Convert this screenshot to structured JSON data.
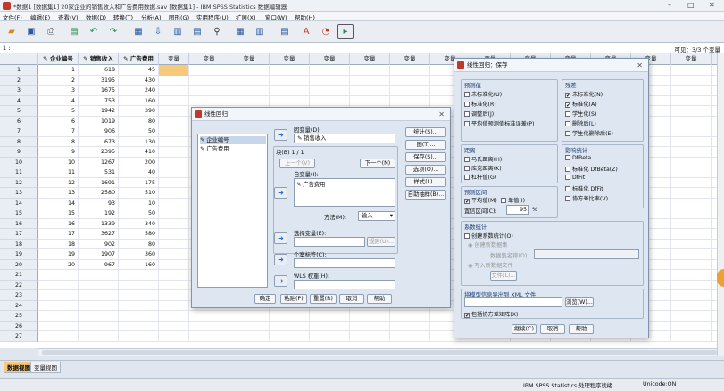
{
  "window": {
    "title": "*数据1 [数据集1] 20家企业的销售收入和广告费用数据.sav [数据集1] - IBM SPSS Statistics 数据编辑器"
  },
  "menu": [
    "文件(F)",
    "编辑(E)",
    "查看(V)",
    "数据(D)",
    "转换(T)",
    "分析(A)",
    "图形(G)",
    "实用程序(U)",
    "扩展(X)",
    "窗口(W)",
    "帮助(H)"
  ],
  "cellbar": {
    "ref": "1 :",
    "visible": "可见：3/3 个变量"
  },
  "grid": {
    "columns": [
      "企业编号",
      "销售收入",
      "广告费用",
      "变量",
      "变量",
      "变量",
      "变量",
      "变量",
      "变量",
      "变量",
      "变量",
      "变量",
      "变量",
      "变量",
      "变量",
      "变量",
      "变量"
    ],
    "rows": [
      [
        "1",
        "618",
        "45"
      ],
      [
        "2",
        "3195",
        "430"
      ],
      [
        "3",
        "1675",
        "240"
      ],
      [
        "4",
        "753",
        "160"
      ],
      [
        "5",
        "1942",
        "390"
      ],
      [
        "6",
        "1019",
        "80"
      ],
      [
        "7",
        "906",
        "50"
      ],
      [
        "8",
        "673",
        "130"
      ],
      [
        "9",
        "2395",
        "410"
      ],
      [
        "10",
        "1267",
        "200"
      ],
      [
        "11",
        "531",
        "40"
      ],
      [
        "12",
        "1691",
        "175"
      ],
      [
        "13",
        "2580",
        "510"
      ],
      [
        "14",
        "93",
        "10"
      ],
      [
        "15",
        "192",
        "50"
      ],
      [
        "16",
        "1339",
        "340"
      ],
      [
        "17",
        "3627",
        "580"
      ],
      [
        "18",
        "902",
        "80"
      ],
      [
        "19",
        "1907",
        "360"
      ],
      [
        "20",
        "967",
        "160"
      ],
      [
        "",
        "",
        ""
      ],
      [
        "",
        "",
        ""
      ],
      [
        "",
        "",
        ""
      ],
      [
        "",
        "",
        ""
      ],
      [
        "",
        "",
        ""
      ],
      [
        "",
        "",
        ""
      ],
      [
        "",
        "",
        ""
      ]
    ]
  },
  "tabs": {
    "data_view": "数据视图",
    "variable_view": "变量视图"
  },
  "status": {
    "processor": "IBM SPSS Statistics 处理程序就绪",
    "unicode": "Unicode:ON"
  },
  "regression": {
    "title": "线性回归",
    "source_vars": [
      "企业编号",
      "广告费用"
    ],
    "dependent_label": "因变量(D):",
    "dependent_value": "销售收入",
    "block_label": "块(B) 1 / 1",
    "prev": "上一个(V)",
    "next": "下一个(N)",
    "independent_label": "自变量(I):",
    "independent_value": "广告费用",
    "method_label": "方法(M):",
    "method_value": "输入",
    "selection_label": "选择变量(E):",
    "rule_btn": "规则(U)...",
    "case_label": "个案标签(C):",
    "wls_label": "WLS 权重(H):",
    "side_buttons": [
      "统计(S)...",
      "图(T)...",
      "保存(S)...",
      "选项(O)...",
      "样式(L)...",
      "自助抽样(B)..."
    ],
    "ok": "确定",
    "paste": "粘贴(P)",
    "reset": "重置(R)",
    "cancel": "取消",
    "help": "帮助"
  },
  "save": {
    "title": "线性回归：保存",
    "predicted": {
      "title": "预测值",
      "items": [
        {
          "label": "未标准化(U)",
          "checked": false
        },
        {
          "label": "标准化(R)",
          "checked": false
        },
        {
          "label": "调整后(J)",
          "checked": false
        },
        {
          "label": "平均值预测值标准误差(P)",
          "checked": false
        }
      ]
    },
    "residuals": {
      "title": "残差",
      "items": [
        {
          "label": "未标准化(N)",
          "checked": true
        },
        {
          "label": "标准化(A)",
          "checked": true
        },
        {
          "label": "学生化(S)",
          "checked": false
        },
        {
          "label": "删除后(L)",
          "checked": false
        },
        {
          "label": "学生化删除后(E)",
          "checked": false
        }
      ]
    },
    "distances": {
      "title": "距离",
      "items": [
        {
          "label": "马氏距离(H)",
          "checked": false
        },
        {
          "label": "库克距离(K)",
          "checked": false
        },
        {
          "label": "杠杆值(G)",
          "checked": false
        }
      ]
    },
    "influence": {
      "title": "影响统计",
      "items": [
        {
          "label": "DfBeta",
          "checked": false
        },
        {
          "label": "标准化 DfBeta(Z)",
          "checked": false
        },
        {
          "label": "DfFit",
          "checked": false
        },
        {
          "label": "标准化 DfFit",
          "checked": false
        },
        {
          "label": "协方差比率(V)",
          "checked": false
        }
      ]
    },
    "intervals": {
      "title": "预测区间",
      "mean": "平均值(M)",
      "individual": "单值(I)",
      "ci_label": "置信区间(C):",
      "ci_value": "95",
      "pct": "%"
    },
    "coef": {
      "title": "系数统计",
      "create": "创建系数统计(O)",
      "new_ds": "创建新数据集",
      "ds_name": "数据集名称(D):",
      "write": "写入新数据文件",
      "file_btn": "文件(L)..."
    },
    "xml": {
      "title": "将模型信息导出到 XML 文件",
      "browse": "浏览(W)...",
      "include": "包括协方差矩阵(X)"
    },
    "continue": "继续(C)",
    "cancel": "取消",
    "help": "帮助"
  },
  "colors": {
    "accent": "#f0a030",
    "selection": "#f7c97a",
    "dialog": "#dde6f1"
  }
}
